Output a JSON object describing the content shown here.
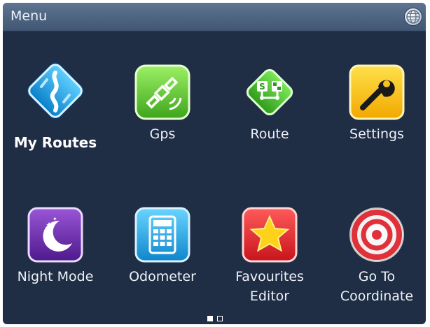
{
  "window": {
    "title": "Menu",
    "globe_icon": "globe-icon"
  },
  "menu": {
    "items": [
      {
        "label": "My Routes",
        "icon": "my-routes-icon",
        "selected": true
      },
      {
        "label": "Gps",
        "icon": "satellite-icon"
      },
      {
        "label": "Route",
        "icon": "route-icon"
      },
      {
        "label": "Settings",
        "icon": "wrench-icon"
      },
      {
        "label": "Night Mode",
        "icon": "moon-icon"
      },
      {
        "label": "Odometer",
        "icon": "calculator-icon"
      },
      {
        "label": "Favourites Editor",
        "label_line1": "Favourites",
        "label_line2": "Editor",
        "icon": "star-icon"
      },
      {
        "label": "Go To Coordinate",
        "label_line1": "Go To",
        "label_line2": "Coordinate",
        "icon": "target-icon"
      }
    ]
  },
  "pager": {
    "current_page": 1,
    "page_count": 2
  },
  "colors": {
    "background": "#1f2e45",
    "titlebar": "#4d6480",
    "text": "#eef2f8"
  }
}
